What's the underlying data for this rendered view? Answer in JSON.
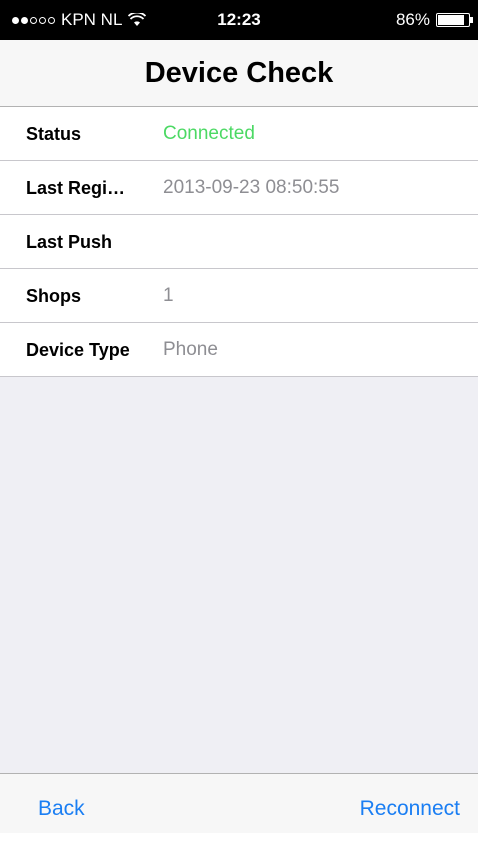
{
  "status_bar": {
    "carrier": "KPN NL",
    "time": "12:23",
    "battery_percent": "86%",
    "battery_level": 0.86,
    "signal_bars_filled": 2,
    "signal_bars_total": 5,
    "wifi_icon": "wifi-icon"
  },
  "nav": {
    "title": "Device Check"
  },
  "table": {
    "rows": [
      {
        "label": "Status",
        "value": "Connected"
      },
      {
        "label": "Last Regi…",
        "value": "2013-09-23 08:50:55"
      },
      {
        "label": "Last Push",
        "value": ""
      },
      {
        "label": "Shops",
        "value": "1"
      },
      {
        "label": "Device Type",
        "value": "Phone"
      }
    ]
  },
  "toolbar": {
    "back_label": "Back",
    "reconnect_label": "Reconnect"
  },
  "colors": {
    "connected": "#4cd964",
    "accent": "#1a7ef3",
    "value_gray": "#8e8e93",
    "background": "#efeff4"
  }
}
